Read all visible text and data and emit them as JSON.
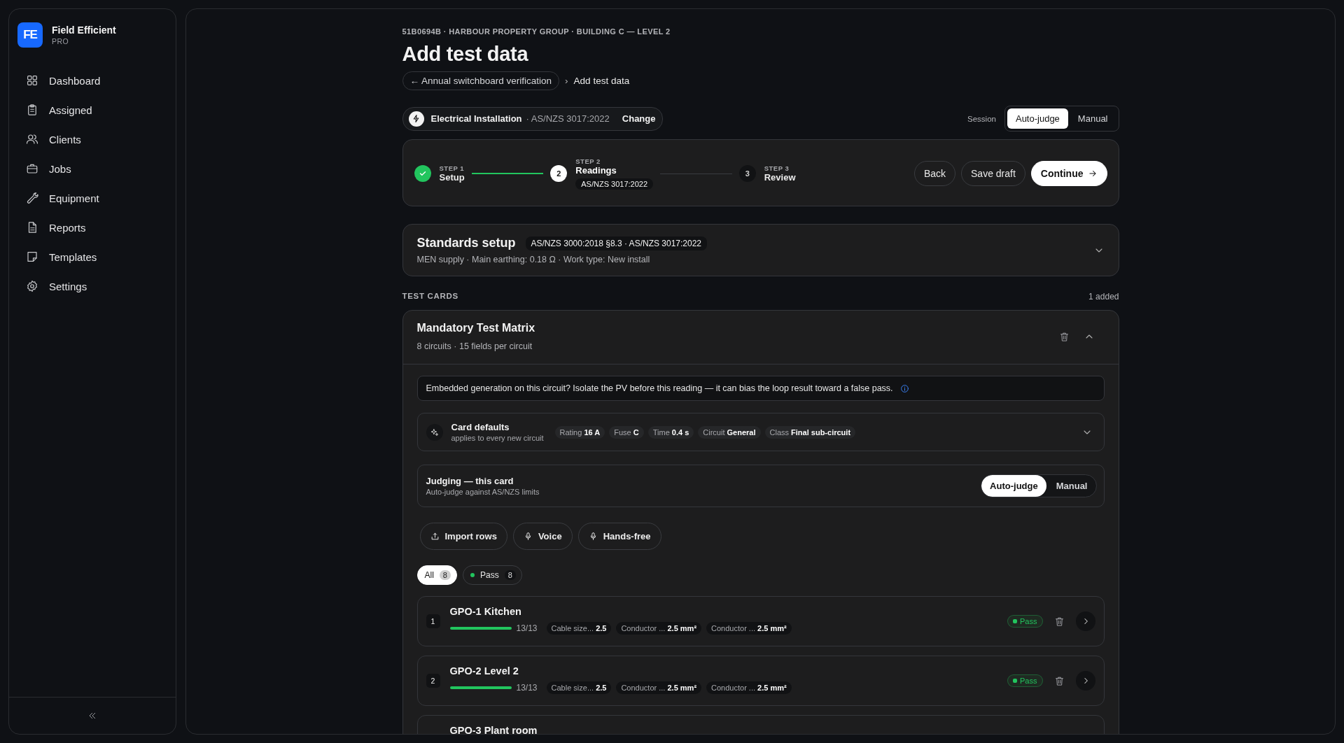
{
  "app": {
    "logo": "FE",
    "name": "Field Efficient",
    "plan": "PRO"
  },
  "sidebar": {
    "items": [
      {
        "label": "Dashboard",
        "selected": false
      },
      {
        "label": "Assigned",
        "selected": false
      },
      {
        "label": "Clients",
        "selected": false
      },
      {
        "label": "Jobs",
        "selected": false
      },
      {
        "label": "Equipment",
        "selected": false
      },
      {
        "label": "Reports",
        "selected": false
      },
      {
        "label": "Templates",
        "selected": false
      },
      {
        "label": "Settings",
        "selected": false
      }
    ]
  },
  "header": {
    "context": "51B0694B · HARBOUR PROPERTY GROUP · BUILDING C — LEVEL 2",
    "title": "Add test data",
    "back_link": "← Annual switchboard verification",
    "separator": "›",
    "current": "Add test data"
  },
  "standard": {
    "name": "Electrical Installation",
    "detail": "· AS/NZS 3017:2022",
    "action": "Change"
  },
  "session": {
    "label": "Session",
    "options": [
      {
        "label": "Auto-judge",
        "selected": true
      },
      {
        "label": "Manual",
        "selected": false
      }
    ]
  },
  "stepper": {
    "steps": [
      {
        "step": "STEP 1",
        "label": "Setup",
        "done": true,
        "selected": false
      },
      {
        "step": "STEP 2",
        "label": "Readings",
        "number": "2",
        "done": false,
        "selected": true,
        "tag": "AS/NZS 3017:2022"
      },
      {
        "step": "STEP 3",
        "label": "Review",
        "number": "3",
        "done": false,
        "selected": false
      }
    ],
    "actions": [
      {
        "label": "Back",
        "kind": "secondary"
      },
      {
        "label": "Save draft",
        "kind": "secondary"
      },
      {
        "label": "Continue",
        "kind": "primary"
      }
    ]
  },
  "standards_setup": {
    "title": "Standards setup",
    "tag": "AS/NZS 3000:2018 §8.3 · AS/NZS 3017:2022",
    "summary": "MEN supply · Main earthing: 0.18 Ω · Work type: New install",
    "expanded": false
  },
  "test_cards": {
    "label": "TEST CARDS",
    "count": "1 added",
    "cards": [
      {
        "title": "Mandatory Test Matrix",
        "subtitle": "8 circuits · 15 fields per circuit",
        "expanded": true,
        "notice": "Embedded generation on this circuit? Isolate the PV before this reading — it can bias the loop result toward a false pass.",
        "defaults": {
          "title": "Card defaults",
          "subtitle": "applies to every new circuit",
          "expanded": false,
          "chips": [
            {
              "label": "Rating",
              "value": "16 A"
            },
            {
              "label": "Fuse",
              "value": "C"
            },
            {
              "label": "Time",
              "value": "0.4 s"
            },
            {
              "label": "Circuit",
              "value": "General"
            },
            {
              "label": "Class",
              "value": "Final sub-circuit"
            }
          ]
        },
        "judging": {
          "title": "Judging — this card",
          "subtitle": "Auto-judge against AS/NZS limits",
          "options": [
            {
              "label": "Auto-judge",
              "selected": true
            },
            {
              "label": "Manual",
              "selected": false
            }
          ]
        },
        "tools": [
          {
            "label": "Import rows",
            "kind": "upload"
          },
          {
            "label": "Voice",
            "kind": "voice"
          },
          {
            "label": "Hands-free",
            "kind": "voice"
          }
        ],
        "filters": [
          {
            "label": "All",
            "count": "8",
            "selected": true
          },
          {
            "label": "Pass",
            "count": "8",
            "selected": false,
            "color": "#22c55e"
          }
        ],
        "circuits": [
          {
            "index": "1",
            "name": "GPO-1 Kitchen",
            "level": 1,
            "progress": "13/13",
            "fields": [
              {
                "label": "Cable size...",
                "value": "2.5"
              },
              {
                "label": "Conductor ...",
                "value": "2.5 mm²"
              },
              {
                "label": "Conductor ...",
                "value": "2.5 mm²"
              }
            ],
            "result": {
              "label": "Pass",
              "kind": "pass"
            }
          },
          {
            "index": "2",
            "name": "GPO-2 Level 2",
            "level": 1,
            "progress": "13/13",
            "fields": [
              {
                "label": "Cable size...",
                "value": "2.5"
              },
              {
                "label": "Conductor ...",
                "value": "2.5 mm²"
              },
              {
                "label": "Conductor ...",
                "value": "2.5 mm²"
              }
            ],
            "result": {
              "label": "Pass",
              "kind": "pass"
            }
          },
          {
            "name": "GPO-3 Plant room"
          }
        ]
      }
    ]
  }
}
